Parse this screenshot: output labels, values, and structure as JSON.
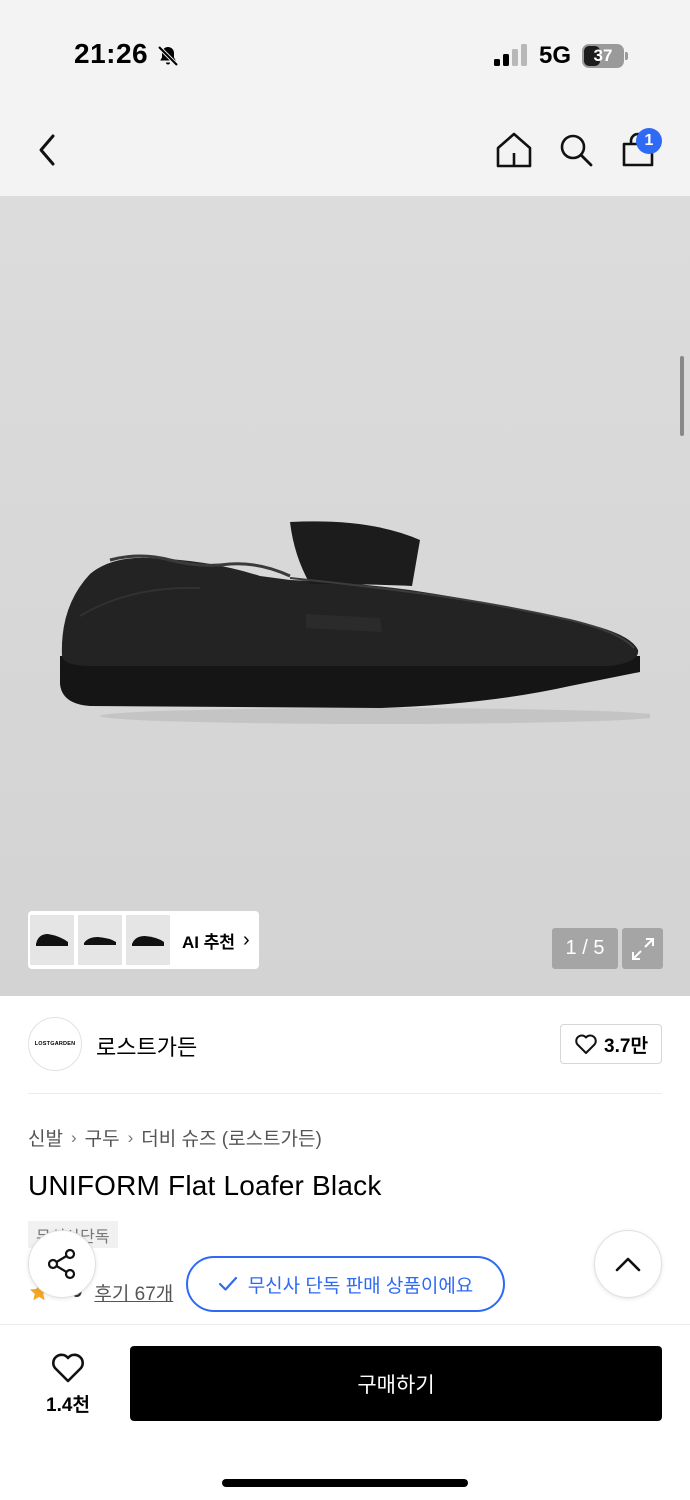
{
  "status_bar": {
    "time": "21:26",
    "network": "5G",
    "battery": "37",
    "icons": [
      "bell-slash-icon",
      "signal-icon",
      "battery-icon"
    ]
  },
  "nav": {
    "cart_count": "1",
    "icons": [
      "chevron-left-icon",
      "home-icon",
      "search-icon",
      "bag-icon"
    ],
    "accent_color": "#2e6af5"
  },
  "gallery": {
    "ai_label": "AI 추천",
    "page_counter": "1 / 5"
  },
  "brand": {
    "logo_text": "LOSTGARDEN",
    "name": "로스트가든",
    "like_count": "3.7만"
  },
  "product": {
    "breadcrumb": [
      "신발",
      "구두",
      "더비 슈즈 (로스트가든)"
    ],
    "title": "UNIFORM Flat Loafer Black",
    "tag": "무신사단독",
    "rating": "4.9",
    "reviews": "후기 67개"
  },
  "toast": {
    "text": "무신사 단독 판매 상품이에요"
  },
  "bottom_bar": {
    "wish_count": "1.4천",
    "buy_label": "구매하기"
  }
}
